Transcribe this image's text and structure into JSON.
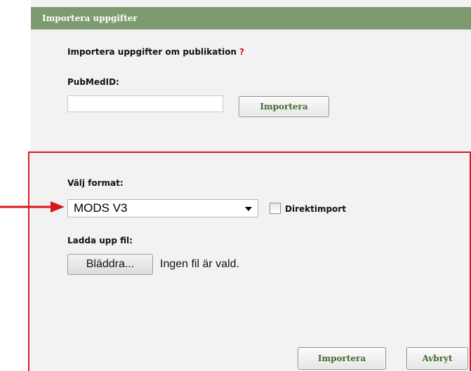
{
  "dialog": {
    "title": "Importera uppgifter"
  },
  "pubmed_section": {
    "heading": "Importera uppgifter om publikation",
    "help_mark": "?",
    "field_label": "PubMedID:",
    "field_value": "",
    "import_button": "Importera"
  },
  "file_section": {
    "format_label": "Välj format:",
    "format_selected": "MODS V3",
    "direct_import_label": "Direktimport",
    "direct_import_checked": false,
    "upload_label": "Ladda upp fil:",
    "browse_button": "Bläddra...",
    "no_file_text": "Ingen fil är vald."
  },
  "footer": {
    "import_button": "Importera",
    "cancel_button": "Avbryt"
  },
  "colors": {
    "titlebar": "#7e9b70",
    "button_text": "#3f6b2c",
    "annotation_red": "#d9161c",
    "help_red": "#c0191e"
  }
}
